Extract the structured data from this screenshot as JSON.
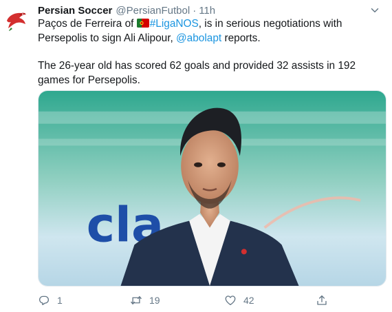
{
  "tweet": {
    "author_name": "Persian Soccer",
    "author_handle": "@PersianFutbol",
    "separator": "·",
    "time": "11h",
    "text1_before": "Paços de Ferreira of ",
    "hashtag": "#LigaNOS",
    "text1_after": ", is in serious negotiations with Persepolis to sign Ali Alipour, ",
    "mention": "@abolapt",
    "text1_end": " reports.",
    "text2": "The 26-year old has scored 62 goals and provided 32 assists in 192 games for Persepolis.",
    "media_text": "cla"
  },
  "actions": {
    "replies": "1",
    "retweets": "19",
    "likes": "42"
  },
  "icons": {
    "avatar": "red-falcon-logo",
    "flag": "portugal-flag-icon",
    "caret": "chevron-down-icon",
    "reply": "reply-icon",
    "retweet": "retweet-icon",
    "like": "heart-icon",
    "share": "share-icon"
  },
  "colors": {
    "link": "#1b95e0",
    "secondary_text": "#657786",
    "brand_red": "#d32f2f"
  }
}
